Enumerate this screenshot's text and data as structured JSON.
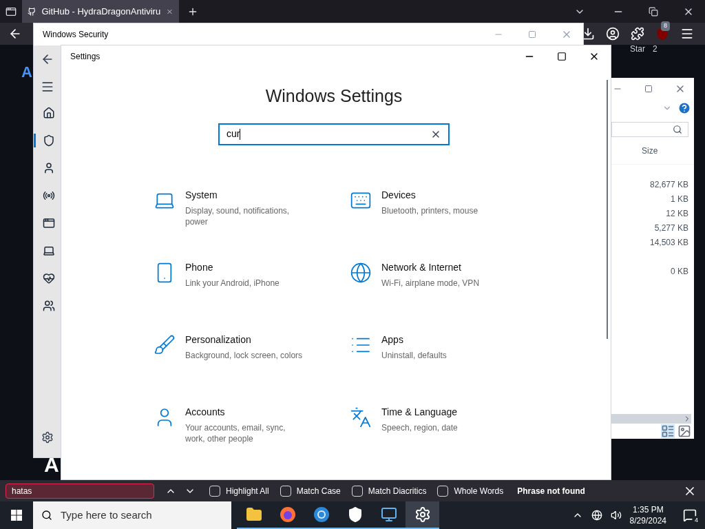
{
  "browser": {
    "tab": {
      "title": "GitHub - HydraDragonAntiviru",
      "selected": true
    },
    "extensions_badge": "8",
    "page_texts": [
      "A",
      "Star",
      "2",
      "A"
    ]
  },
  "security_window": {
    "title": "Windows Security",
    "nav": [
      {
        "selected": false
      },
      {
        "selected": true
      },
      {
        "selected": false
      },
      {
        "selected": false
      },
      {
        "selected": false
      },
      {
        "selected": false
      },
      {
        "selected": false
      },
      {
        "selected": false
      }
    ]
  },
  "settings_window": {
    "title": "Settings",
    "heading": "Windows Settings",
    "search": {
      "value": "cur"
    },
    "categories": [
      {
        "name": "System",
        "description": "Display, sound, notifications, power"
      },
      {
        "name": "Devices",
        "description": "Bluetooth, printers, mouse"
      },
      {
        "name": "Phone",
        "description": "Link your Android, iPhone"
      },
      {
        "name": "Network & Internet",
        "description": "Wi-Fi, airplane mode, VPN"
      },
      {
        "name": "Personalization",
        "description": "Background, lock screen, colors"
      },
      {
        "name": "Apps",
        "description": "Uninstall, defaults"
      },
      {
        "name": "Accounts",
        "description": "Your accounts, email, sync, work, other people"
      },
      {
        "name": "Time & Language",
        "description": "Speech, region, date"
      }
    ]
  },
  "explorer_window": {
    "column": "Size",
    "sizes": [
      "82,677 KB",
      "1 KB",
      "12 KB",
      "5,277 KB",
      "14,503 KB",
      "0 KB"
    ]
  },
  "find_bar": {
    "value": "hatas",
    "not_found": true,
    "options": [
      {
        "label": "Highlight All",
        "checked": false
      },
      {
        "label": "Match Case",
        "checked": false
      },
      {
        "label": "Match Diacritics",
        "checked": false
      },
      {
        "label": "Whole Words",
        "checked": false
      }
    ],
    "status": "Phrase not found"
  },
  "taskbar": {
    "search_placeholder": "Type here to search",
    "apps": [
      {
        "selected": false
      },
      {
        "selected": false
      },
      {
        "selected": false
      },
      {
        "selected": false
      },
      {
        "selected": false
      },
      {
        "selected": true
      }
    ],
    "time": "1:35 PM",
    "date": "8/29/2024",
    "notifications": "4"
  }
}
